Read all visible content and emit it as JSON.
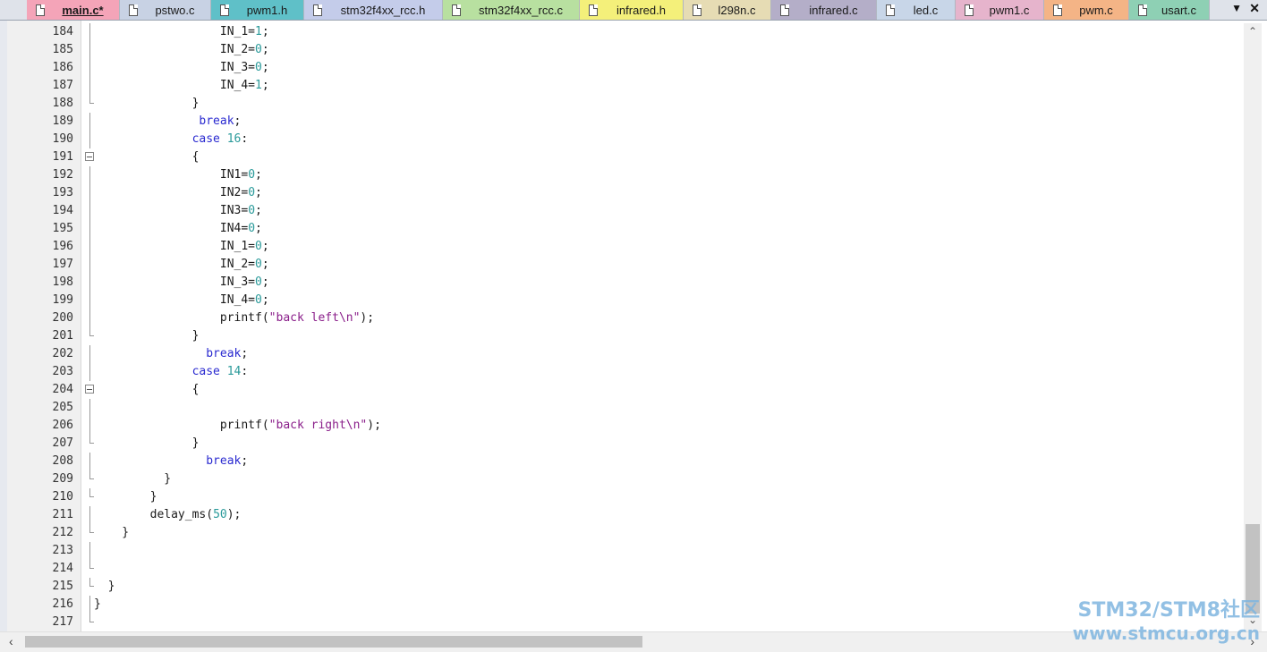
{
  "tabs": [
    {
      "label": "main.c*",
      "color": "#f4a4b8",
      "active": true
    },
    {
      "label": "pstwo.c",
      "color": "#c8d2e4"
    },
    {
      "label": "pwm1.h",
      "color": "#5fc0c8"
    },
    {
      "label": "stm32f4xx_rcc.h",
      "color": "#c4ccea"
    },
    {
      "label": "stm32f4xx_rcc.c",
      "color": "#b8e0a0"
    },
    {
      "label": "infrared.h",
      "color": "#f4f07a"
    },
    {
      "label": "l298n.c",
      "color": "#e6dcb4"
    },
    {
      "label": "infrared.c",
      "color": "#b4aec8"
    },
    {
      "label": "led.c",
      "color": "#c8d6e8"
    },
    {
      "label": "pwm1.c",
      "color": "#e6b4cc"
    },
    {
      "label": "pwm.c",
      "color": "#f4b486"
    },
    {
      "label": "usart.c",
      "color": "#8ed0b4"
    }
  ],
  "tab_menu_icon": "dropdown-arrow-icon",
  "tab_close_icon": "close-icon",
  "colors": {
    "keyword": "#2a2ad0",
    "number": "#2a9a9a",
    "string": "#8a1e8a"
  },
  "lines": [
    {
      "n": "184",
      "fold": "mid",
      "code": [
        [
          "                  IN_1=",
          ""
        ],
        [
          "1",
          "num"
        ],
        [
          ";",
          ""
        ]
      ]
    },
    {
      "n": "185",
      "fold": "mid",
      "code": [
        [
          "                  IN_2=",
          ""
        ],
        [
          "0",
          "num"
        ],
        [
          ";",
          ""
        ]
      ]
    },
    {
      "n": "186",
      "fold": "mid",
      "code": [
        [
          "                  IN_3=",
          ""
        ],
        [
          "0",
          "num"
        ],
        [
          ";",
          ""
        ]
      ]
    },
    {
      "n": "187",
      "fold": "mid",
      "code": [
        [
          "                  IN_4=",
          ""
        ],
        [
          "1",
          "num"
        ],
        [
          ";",
          ""
        ]
      ]
    },
    {
      "n": "188",
      "fold": "end",
      "code": [
        [
          "              }",
          ""
        ]
      ]
    },
    {
      "n": "189",
      "fold": "mid",
      "code": [
        [
          "               ",
          ""
        ],
        [
          "break",
          "kw"
        ],
        [
          ";",
          ""
        ]
      ]
    },
    {
      "n": "190",
      "fold": "mid",
      "code": [
        [
          "              ",
          ""
        ],
        [
          "case",
          "kw"
        ],
        [
          " ",
          ""
        ],
        [
          "16",
          "num"
        ],
        [
          ":",
          ""
        ]
      ]
    },
    {
      "n": "191",
      "fold": "box",
      "code": [
        [
          "              {",
          ""
        ]
      ]
    },
    {
      "n": "192",
      "fold": "mid",
      "code": [
        [
          "                  IN1=",
          ""
        ],
        [
          "0",
          "num"
        ],
        [
          ";",
          ""
        ]
      ]
    },
    {
      "n": "193",
      "fold": "mid",
      "code": [
        [
          "                  IN2=",
          ""
        ],
        [
          "0",
          "num"
        ],
        [
          ";",
          ""
        ]
      ]
    },
    {
      "n": "194",
      "fold": "mid",
      "code": [
        [
          "                  IN3=",
          ""
        ],
        [
          "0",
          "num"
        ],
        [
          ";",
          ""
        ]
      ]
    },
    {
      "n": "195",
      "fold": "mid",
      "code": [
        [
          "                  IN4=",
          ""
        ],
        [
          "0",
          "num"
        ],
        [
          ";",
          ""
        ]
      ]
    },
    {
      "n": "196",
      "fold": "mid",
      "code": [
        [
          "                  IN_1=",
          ""
        ],
        [
          "0",
          "num"
        ],
        [
          ";",
          ""
        ]
      ]
    },
    {
      "n": "197",
      "fold": "mid",
      "code": [
        [
          "                  IN_2=",
          ""
        ],
        [
          "0",
          "num"
        ],
        [
          ";",
          ""
        ]
      ]
    },
    {
      "n": "198",
      "fold": "mid",
      "code": [
        [
          "                  IN_3=",
          ""
        ],
        [
          "0",
          "num"
        ],
        [
          ";",
          ""
        ]
      ]
    },
    {
      "n": "199",
      "fold": "mid",
      "code": [
        [
          "                  IN_4=",
          ""
        ],
        [
          "0",
          "num"
        ],
        [
          ";",
          ""
        ]
      ]
    },
    {
      "n": "200",
      "fold": "mid",
      "code": [
        [
          "                  printf(",
          ""
        ],
        [
          "\"back left\\n\"",
          "str"
        ],
        [
          ");",
          ""
        ]
      ]
    },
    {
      "n": "201",
      "fold": "end",
      "code": [
        [
          "              }",
          ""
        ]
      ]
    },
    {
      "n": "202",
      "fold": "mid",
      "code": [
        [
          "                ",
          ""
        ],
        [
          "break",
          "kw"
        ],
        [
          ";",
          ""
        ]
      ]
    },
    {
      "n": "203",
      "fold": "mid",
      "code": [
        [
          "              ",
          ""
        ],
        [
          "case",
          "kw"
        ],
        [
          " ",
          ""
        ],
        [
          "14",
          "num"
        ],
        [
          ":",
          ""
        ]
      ]
    },
    {
      "n": "204",
      "fold": "box",
      "code": [
        [
          "              {",
          ""
        ]
      ]
    },
    {
      "n": "205",
      "fold": "mid",
      "code": []
    },
    {
      "n": "206",
      "fold": "mid",
      "code": [
        [
          "                  printf(",
          ""
        ],
        [
          "\"back right\\n\"",
          "str"
        ],
        [
          ");",
          ""
        ]
      ]
    },
    {
      "n": "207",
      "fold": "end",
      "code": [
        [
          "              }",
          ""
        ]
      ]
    },
    {
      "n": "208",
      "fold": "mid",
      "code": [
        [
          "                ",
          ""
        ],
        [
          "break",
          "kw"
        ],
        [
          ";",
          ""
        ]
      ]
    },
    {
      "n": "209",
      "fold": "end",
      "code": [
        [
          "          }",
          ""
        ]
      ]
    },
    {
      "n": "210",
      "fold": "end",
      "code": [
        [
          "        }",
          ""
        ]
      ]
    },
    {
      "n": "211",
      "fold": "mid",
      "code": [
        [
          "        delay_ms(",
          ""
        ],
        [
          "50",
          "num"
        ],
        [
          ");",
          ""
        ]
      ]
    },
    {
      "n": "212",
      "fold": "end",
      "code": [
        [
          "    }",
          ""
        ]
      ]
    },
    {
      "n": "213",
      "fold": "mid",
      "code": []
    },
    {
      "n": "214",
      "fold": "end",
      "code": []
    },
    {
      "n": "215",
      "fold": "end",
      "code": [
        [
          "  }",
          ""
        ]
      ]
    },
    {
      "n": "216",
      "fold": "mid",
      "code": [
        [
          "}",
          ""
        ]
      ]
    },
    {
      "n": "217",
      "fold": "last",
      "code": []
    }
  ],
  "scroll": {
    "up": "▲",
    "down": "▼",
    "left": "◀",
    "right": "▶",
    "vertical_position": 0.88,
    "horizontal_position": 0.0
  },
  "watermark": {
    "line1": "STM32/STM8社区",
    "line2": "www.stmcu.org.cn"
  }
}
